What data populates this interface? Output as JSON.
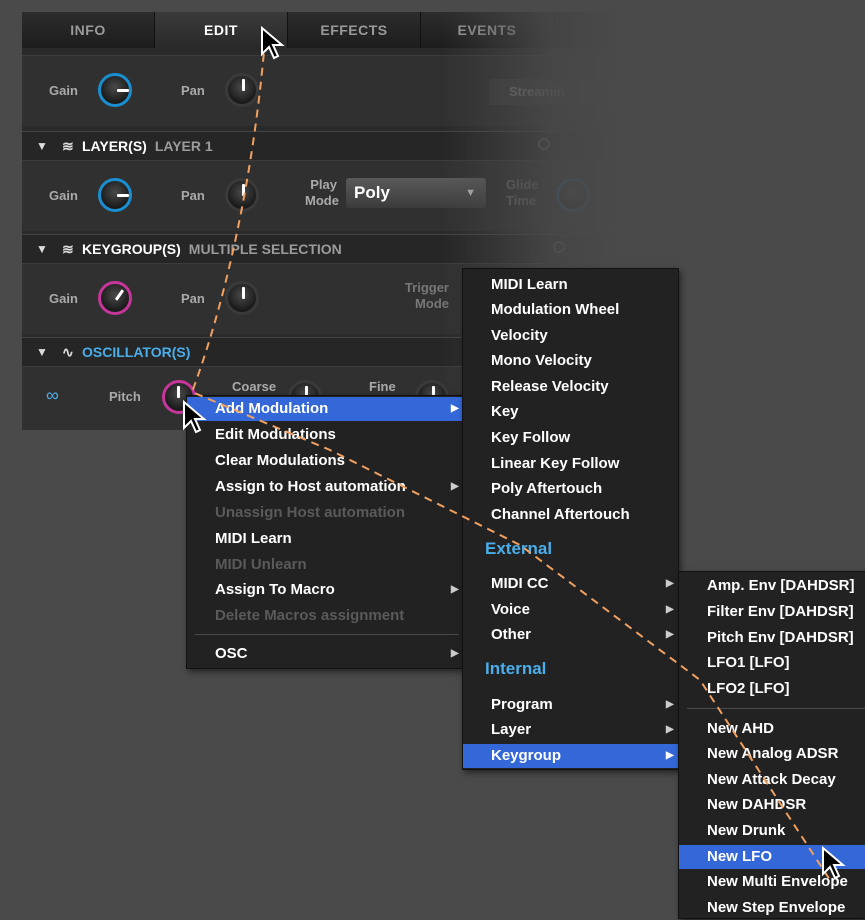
{
  "tabs": [
    "INFO",
    "EDIT",
    "EFFECTS",
    "EVENTS"
  ],
  "program_row": {
    "gain": "Gain",
    "pan": "Pan",
    "streaming": "Streamin"
  },
  "layer": {
    "title": "LAYER(S)",
    "sub": "LAYER 1",
    "gain": "Gain",
    "pan": "Pan",
    "play_mode_1": "Play",
    "play_mode_2": "Mode",
    "play_mode_value": "Poly",
    "glide_1": "Glide",
    "glide_2": "Time"
  },
  "keygroup": {
    "title": "KEYGROUP(S)",
    "sub": "MULTIPLE SELECTION",
    "gain": "Gain",
    "pan": "Pan",
    "trigger_1": "Trigger",
    "trigger_2": "Mode"
  },
  "oscillator": {
    "title": "OSCILLATOR(S)",
    "pitch": "Pitch",
    "coarse": "Coarse",
    "fine": "Fine"
  },
  "context_menu": {
    "items": [
      "Add Modulation",
      "Edit Modulations",
      "Clear Modulations",
      "Assign to Host automation",
      "Unassign Host automation",
      "MIDI Learn",
      "MIDI Unlearn",
      "Assign To Macro",
      "Delete Macros assignment",
      "OSC"
    ]
  },
  "mod_menu": {
    "items": [
      "MIDI Learn",
      "Modulation Wheel",
      "Velocity",
      "Mono Velocity",
      "Release Velocity",
      "Key",
      "Key Follow",
      "Linear Key Follow",
      "Poly Aftertouch",
      "Channel Aftertouch"
    ],
    "external_head": "External",
    "external_items": [
      "MIDI CC",
      "Voice",
      "Other"
    ],
    "internal_head": "Internal",
    "internal_items": [
      "Program",
      "Layer",
      "Keygroup"
    ]
  },
  "keygroup_menu": {
    "existing": [
      "Amp. Env [DAHDSR]",
      "Filter Env [DAHDSR]",
      "Pitch Env [DAHDSR]",
      "LFO1 [LFO]",
      "LFO2 [LFO]"
    ],
    "new_items": [
      "New AHD",
      "New Analog ADSR",
      "New Attack Decay",
      "New DAHDSR",
      "New Drunk",
      "New LFO",
      "New Multi Envelope",
      "New Step Envelope"
    ]
  },
  "colors": {
    "highlight": "#3468d8",
    "section_heading": "#4aaeea",
    "knob_blue": "#1a8fd0",
    "knob_pink": "#c6359a",
    "path": "#f0a060"
  }
}
